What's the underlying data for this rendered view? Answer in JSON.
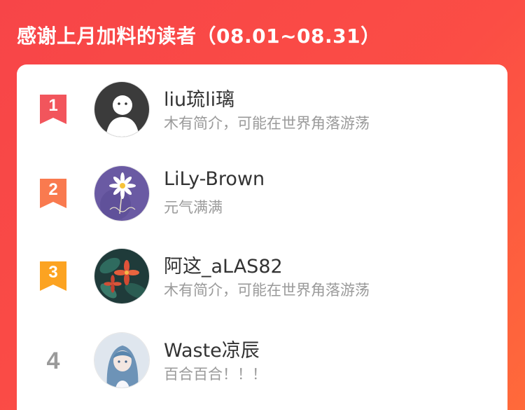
{
  "header": {
    "title": "感谢上月加料的读者（08.01~08.31）",
    "colors": {
      "gradient_start": "#f74548",
      "gradient_end": "#ff6a3a"
    }
  },
  "leaderboard": {
    "rows": [
      {
        "rank": "1",
        "name": "liu琉li璃",
        "bio": "木有简介，可能在世界角落游荡",
        "badge_color": "#f2555c",
        "avatar": "default-ghost-avatar"
      },
      {
        "rank": "2",
        "name": "LiLy-Brown",
        "bio": "元气满满",
        "badge_color": "#f97a4f",
        "avatar": "daisy-purple-avatar"
      },
      {
        "rank": "3",
        "name": "阿这_aLAS82",
        "bio": "木有简介，可能在世界角落游荡",
        "badge_color": "#fca321",
        "avatar": "flowers-dark-avatar"
      },
      {
        "rank": "4",
        "name": "Waste凉辰",
        "bio": "百合百合！！！",
        "badge_color": "",
        "avatar": "anime-girl-avatar"
      }
    ]
  }
}
